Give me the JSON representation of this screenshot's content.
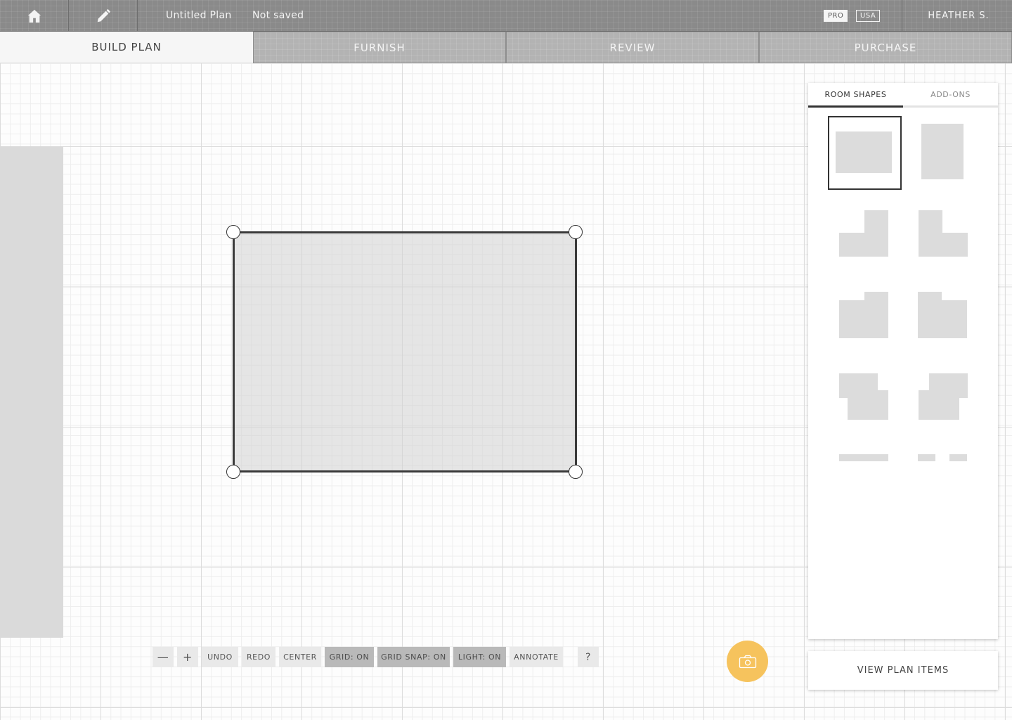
{
  "app": {
    "plan_title": "Untitled Plan",
    "save_status": "Not saved",
    "badges": {
      "pro": "PRO",
      "region": "USA"
    },
    "user_name": "HEATHER S."
  },
  "icons": {
    "home": "home-icon",
    "edit": "pencil-icon",
    "camera": "camera-icon"
  },
  "steps": [
    {
      "label": "BUILD PLAN",
      "active": true
    },
    {
      "label": "FURNISH",
      "active": false
    },
    {
      "label": "REVIEW",
      "active": false
    },
    {
      "label": "PURCHASE",
      "active": false
    }
  ],
  "toolbar": {
    "zoom_out": "—",
    "zoom_in": "+",
    "undo": "UNDO",
    "redo": "REDO",
    "center": "CENTER",
    "grid": "GRID: ON",
    "grid_snap": "GRID SNAP: ON",
    "light": "LIGHT: ON",
    "annotate": "ANNOTATE",
    "help": "?"
  },
  "panel": {
    "tabs": [
      {
        "label": "ROOM SHAPES",
        "active": true
      },
      {
        "label": "ADD-ONS",
        "active": false
      }
    ],
    "shapes": [
      "rectangle",
      "tall-rectangle",
      "l-shape-right",
      "l-shape-left",
      "notch-right",
      "notch-left",
      "offset-right",
      "offset-left",
      "wall",
      "wall-with-gap"
    ],
    "selected_shape": "rectangle"
  },
  "view_plan_items": "VIEW PLAN ITEMS",
  "colors": {
    "topbar": "#8a8a8a",
    "tab_inactive": "#b3b3b3",
    "toggle_on": "#b9b9b9",
    "camera_accent": "#f6c35d",
    "shape_fill": "#dcdcdc"
  }
}
